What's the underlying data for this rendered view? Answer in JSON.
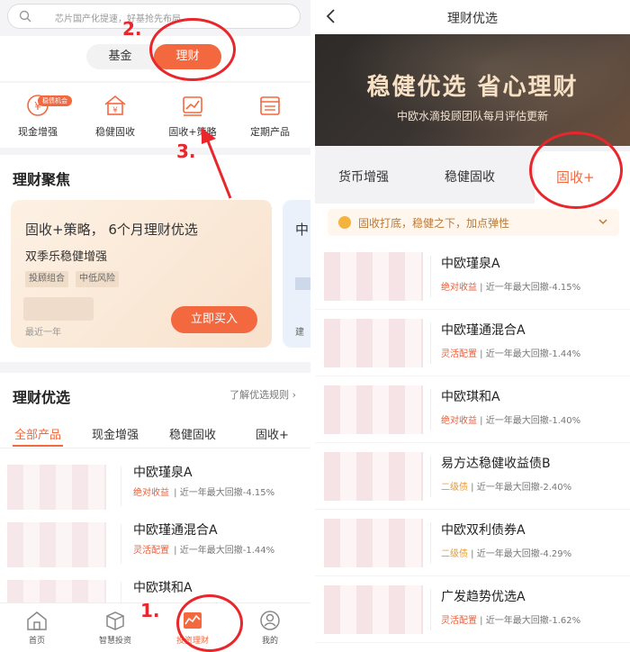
{
  "left": {
    "search_placeholder": "芯片国产化提速，好基抢先布局",
    "segments": {
      "fund": "基金",
      "wealth": "理财"
    },
    "icon_row": [
      {
        "label": "现金增强",
        "badge": "稳债机会",
        "icon": "coin-icon"
      },
      {
        "label": "稳健固收",
        "icon": "house-icon"
      },
      {
        "label": "固收+策略",
        "icon": "chart-icon"
      },
      {
        "label": "定期产品",
        "icon": "calendar-icon"
      }
    ],
    "focus": {
      "title": "理财聚焦",
      "card": {
        "headline": "固收+策略， 6个月理财优选",
        "name": "双季乐稳健增强",
        "tags": [
          "投顾组合",
          "中低风险"
        ],
        "sub": "最近一年",
        "button": "立即买入"
      },
      "card2": {
        "initial": "中",
        "bottom": "建"
      }
    },
    "selection": {
      "title": "理财优选",
      "more": "了解优选规则",
      "tabs": [
        "全部产品",
        "现金增强",
        "稳健固收",
        "固收+"
      ],
      "rows": [
        {
          "name": "中欧瑾泉A",
          "tag": "绝对收益",
          "metric": "近一年最大回撤-4.15%",
          "tag_color": "#e85d3a"
        },
        {
          "name": "中欧瑾通混合A",
          "tag": "灵活配置",
          "metric": "近一年最大回撤-1.44%",
          "tag_color": "#e85d3a"
        },
        {
          "name": "中欧琪和A",
          "tag": "",
          "metric": "",
          "tag_color": "#e85d3a"
        }
      ]
    },
    "bottom_nav": [
      {
        "label": "首页",
        "icon": "home-icon"
      },
      {
        "label": "智慧投资",
        "icon": "box-icon"
      },
      {
        "label": "投资理财",
        "icon": "chart-bar-icon",
        "active": true
      },
      {
        "label": "我的",
        "icon": "user-icon"
      }
    ],
    "annotations": [
      "1.",
      "2.",
      "3."
    ]
  },
  "right": {
    "header_title": "理财优选",
    "banner": {
      "title": "稳健优选  省心理财",
      "subtitle": "中欧水滴投顾团队每月评估更新"
    },
    "tabs": [
      "货币增强",
      "稳健固收",
      "固收+"
    ],
    "tip": "固收打底，稳健之下，加点弹性",
    "rows": [
      {
        "name": "中欧瑾泉A",
        "tag": "绝对收益",
        "metric": "近一年最大回撤-4.15%",
        "tag_class": "red"
      },
      {
        "name": "中欧瑾通混合A",
        "tag": "灵活配置",
        "metric": "近一年最大回撤-1.44%",
        "tag_class": "red"
      },
      {
        "name": "中欧琪和A",
        "tag": "绝对收益",
        "metric": "近一年最大回撤-1.40%",
        "tag_class": "red"
      },
      {
        "name": "易方达稳健收益债B",
        "tag": "二级债",
        "metric": "近一年最大回撤-2.40%",
        "tag_class": "orange"
      },
      {
        "name": "中欧双利债券A",
        "tag": "二级债",
        "metric": "近一年最大回撤-4.29%",
        "tag_class": "orange"
      },
      {
        "name": "广发趋势优选A",
        "tag": "灵活配置",
        "metric": "近一年最大回撤-1.62%",
        "tag_class": "red"
      }
    ]
  },
  "colors": {
    "accent": "#f3683f",
    "annotation": "#e8262b"
  }
}
